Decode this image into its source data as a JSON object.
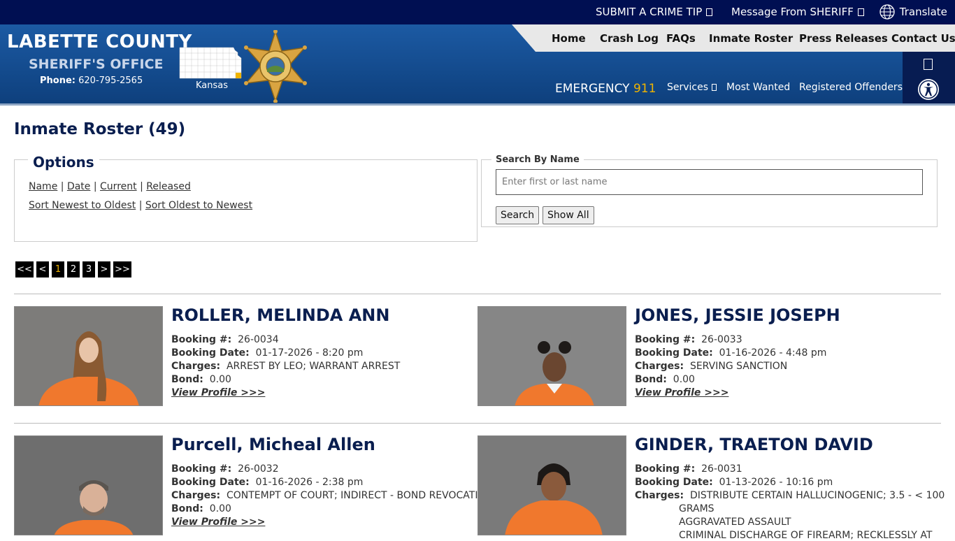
{
  "topbar": {
    "crime_tip": "SUBMIT A CRIME TIP",
    "message": "Message From SHERIFF",
    "translate": "Translate"
  },
  "brand": {
    "line1": "LABETTE COUNTY",
    "line2": "SHERIFF'S OFFICE",
    "phone_label": "Phone:",
    "phone": "620-795-2565",
    "state": "Kansas"
  },
  "nav": {
    "items": [
      "Home",
      "Crash Log",
      "FAQs",
      "Inmate Roster",
      "Press Releases",
      "Contact Us"
    ],
    "emergency_label": "EMERGENCY",
    "emergency_number": "911",
    "services": "Services",
    "most_wanted": "Most Wanted",
    "registered_offenders": "Registered Offenders"
  },
  "page": {
    "title": "Inmate Roster (49)"
  },
  "options": {
    "legend": "Options",
    "filters": [
      "Name",
      "Date",
      "Current",
      "Released"
    ],
    "sorts": [
      "Sort Newest to Oldest",
      "Sort Oldest to Newest"
    ],
    "separator": "|"
  },
  "search": {
    "legend": "Search By Name",
    "placeholder": "Enter first or last name",
    "search_button": "Search",
    "show_all_button": "Show All"
  },
  "pager": [
    "<<",
    "<",
    "1",
    "2",
    "3",
    ">",
    ">>"
  ],
  "pager_current": "1",
  "labels": {
    "booking_no": "Booking #:",
    "booking_date": "Booking Date:",
    "charges": "Charges:",
    "bond": "Bond:",
    "view_profile": "View Profile >>>"
  },
  "inmates": [
    {
      "name": "ROLLER, MELINDA ANN",
      "booking_no": "26-0034",
      "booking_date": "01-17-2026 - 8:20 pm",
      "charges": [
        "ARREST BY LEO; WARRANT ARREST"
      ],
      "bond": "0.00"
    },
    {
      "name": "JONES, JESSIE JOSEPH",
      "booking_no": "26-0033",
      "booking_date": "01-16-2026 - 4:48 pm",
      "charges": [
        "SERVING SANCTION"
      ],
      "bond": "0.00"
    },
    {
      "name": "Purcell, Micheal Allen",
      "booking_no": "26-0032",
      "booking_date": "01-16-2026 - 2:38 pm",
      "charges": [
        "CONTEMPT OF COURT; INDIRECT - BOND REVOCATION"
      ],
      "bond": "0.00"
    },
    {
      "name": "GINDER, TRAETON DAVID",
      "booking_no": "26-0031",
      "booking_date": "01-13-2026 - 10:16 pm",
      "charges": [
        "DISTRIBUTE CERTAIN HALLUCINOGENIC; 3.5 - < 100",
        "GRAMS",
        "AGGRAVATED ASSAULT",
        "CRIMINAL DISCHARGE OF FIREARM; RECKLESSLY AT"
      ]
    }
  ],
  "colors": {
    "topbar": "#000f52",
    "header": "#134a8c",
    "title": "#0a1e4f",
    "accent": "#f0b400",
    "uniform": "#f0782d"
  }
}
